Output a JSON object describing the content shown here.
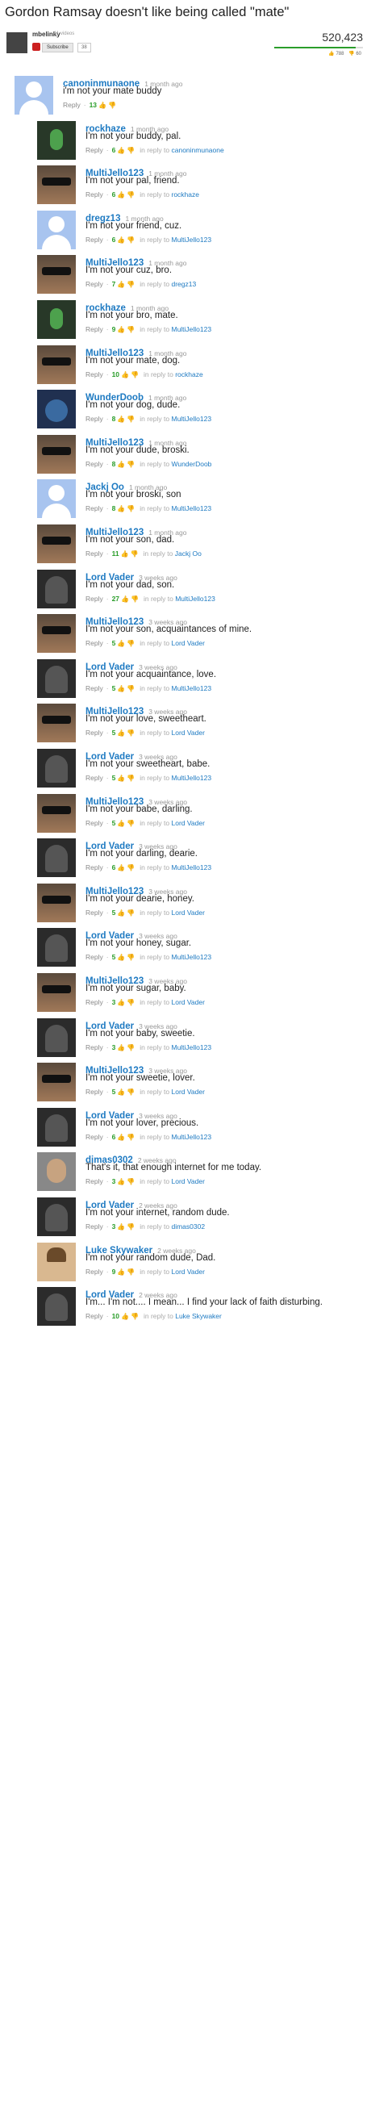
{
  "video": {
    "title": "Gordon Ramsay doesn't like being called \"mate\"",
    "channel": "mbelinky",
    "videos": "11 videos",
    "subscribe_label": "Subscribe",
    "subscriber_count": "38",
    "views": "520,423",
    "likes": "788",
    "dislikes": "60"
  },
  "labels": {
    "reply": "Reply",
    "in_reply_to": "in reply to",
    "thumb_up": "👍",
    "thumb_down": "👎"
  },
  "comments": [
    {
      "user": "canoninmunaone",
      "time": "1 month ago",
      "text": "i'm not your mate buddy",
      "score": "13",
      "reply_to": null,
      "avatar": "default-avatar"
    },
    {
      "user": "rockhaze",
      "time": "1 month ago",
      "text": "I'm not your buddy, pal.",
      "score": "6",
      "reply_to": "canoninmunaone",
      "avatar": "dark-figure-avatar"
    },
    {
      "user": "MultiJello123",
      "time": "1 month ago",
      "text": "I'm not your pal, friend.",
      "score": "6",
      "reply_to": "rockhaze",
      "avatar": "sunglasses-avatar"
    },
    {
      "user": "dregz13",
      "time": "1 month ago",
      "text": "I'm not your friend, cuz.",
      "score": "6",
      "reply_to": "MultiJello123",
      "avatar": "default-avatar"
    },
    {
      "user": "MultiJello123",
      "time": "1 month ago",
      "text": "I'm not your cuz, bro.",
      "score": "7",
      "reply_to": "dregz13",
      "avatar": "sunglasses-avatar"
    },
    {
      "user": "rockhaze",
      "time": "1 month ago",
      "text": "I'm not your bro, mate.",
      "score": "9",
      "reply_to": "MultiJello123",
      "avatar": "dark-figure-avatar"
    },
    {
      "user": "MultiJello123",
      "time": "1 month ago",
      "text": "I'm not your mate, dog.",
      "score": "10",
      "reply_to": "rockhaze",
      "avatar": "sunglasses-avatar"
    },
    {
      "user": "WunderDoob",
      "time": "1 month ago",
      "text": "I'm not your dog, dude.",
      "score": "8",
      "reply_to": "MultiJello123",
      "avatar": "cartoon-avatar"
    },
    {
      "user": "MultiJello123",
      "time": "1 month ago",
      "text": "I'm not your dude, broski.",
      "score": "8",
      "reply_to": "WunderDoob",
      "avatar": "sunglasses-avatar"
    },
    {
      "user": "Jackj Oo",
      "time": "1 month ago",
      "text": "I'm not your broski, son",
      "score": "8",
      "reply_to": "MultiJello123",
      "avatar": "default-avatar"
    },
    {
      "user": "MultiJello123",
      "time": "1 month ago",
      "text": "I'm not your son, dad.",
      "score": "11",
      "reply_to": "Jackj Oo",
      "avatar": "sunglasses-avatar"
    },
    {
      "user": "Lord Vader",
      "time": "3 weeks ago",
      "text": "I'm not your dad, son.",
      "score": "27",
      "reply_to": "MultiJello123",
      "avatar": "vader-avatar"
    },
    {
      "user": "MultiJello123",
      "time": "3 weeks ago",
      "text": "I'm not your son, acquaintances of mine.",
      "score": "5",
      "reply_to": "Lord Vader",
      "avatar": "sunglasses-avatar"
    },
    {
      "user": "Lord Vader",
      "time": "3 weeks ago",
      "text": "I'm not your acquaintance, love.",
      "score": "5",
      "reply_to": "MultiJello123",
      "avatar": "vader-avatar"
    },
    {
      "user": "MultiJello123",
      "time": "3 weeks ago",
      "text": "I'm not your love, sweetheart.",
      "score": "5",
      "reply_to": "Lord Vader",
      "avatar": "sunglasses-avatar"
    },
    {
      "user": "Lord Vader",
      "time": "3 weeks ago",
      "text": "I'm not your sweetheart, babe.",
      "score": "5",
      "reply_to": "MultiJello123",
      "avatar": "vader-avatar"
    },
    {
      "user": "MultiJello123",
      "time": "3 weeks ago",
      "text": "I'm not your babe, darling.",
      "score": "5",
      "reply_to": "Lord Vader",
      "avatar": "sunglasses-avatar"
    },
    {
      "user": "Lord Vader",
      "time": "3 weeks ago",
      "text": "I'm not your darling, dearie.",
      "score": "6",
      "reply_to": "MultiJello123",
      "avatar": "vader-avatar"
    },
    {
      "user": "MultiJello123",
      "time": "3 weeks ago",
      "text": "I'm not your dearie, honey.",
      "score": "5",
      "reply_to": "Lord Vader",
      "avatar": "sunglasses-avatar"
    },
    {
      "user": "Lord Vader",
      "time": "3 weeks ago",
      "text": "I'm not your honey, sugar.",
      "score": "5",
      "reply_to": "MultiJello123",
      "avatar": "vader-avatar"
    },
    {
      "user": "MultiJello123",
      "time": "3 weeks ago",
      "text": "I'm not your sugar, baby.",
      "score": "3",
      "reply_to": "Lord Vader",
      "avatar": "sunglasses-avatar"
    },
    {
      "user": "Lord Vader",
      "time": "3 weeks ago",
      "text": "I'm not your baby, sweetie.",
      "score": "3",
      "reply_to": "MultiJello123",
      "avatar": "vader-avatar"
    },
    {
      "user": "MultiJello123",
      "time": "3 weeks ago",
      "text": "I'm not your sweetie, lover.",
      "score": "5",
      "reply_to": "Lord Vader",
      "avatar": "sunglasses-avatar"
    },
    {
      "user": "Lord Vader",
      "time": "3 weeks ago",
      "text": "I'm not your lover, precious.",
      "score": "6",
      "reply_to": "MultiJello123",
      "avatar": "vader-avatar"
    },
    {
      "user": "dimas0302",
      "time": "2 weeks ago",
      "text": "That's it, that enough internet for me today.",
      "score": "3",
      "reply_to": "Lord Vader",
      "avatar": "photo-avatar"
    },
    {
      "user": "Lord Vader",
      "time": "2 weeks ago",
      "text": "I'm not your internet, random dude.",
      "score": "3",
      "reply_to": "dimas0302",
      "avatar": "vader-avatar"
    },
    {
      "user": "Luke Skywaker",
      "time": "2 weeks ago",
      "text": "I'm not your random dude, Dad.",
      "score": "9",
      "reply_to": "Lord Vader",
      "avatar": "kid-avatar"
    },
    {
      "user": "Lord Vader",
      "time": "2 weeks ago",
      "text": "I'm... I'm not.... I mean... I find your lack of faith disturbing.",
      "score": "10",
      "reply_to": "Luke Skywaker",
      "avatar": "vader-avatar"
    }
  ]
}
